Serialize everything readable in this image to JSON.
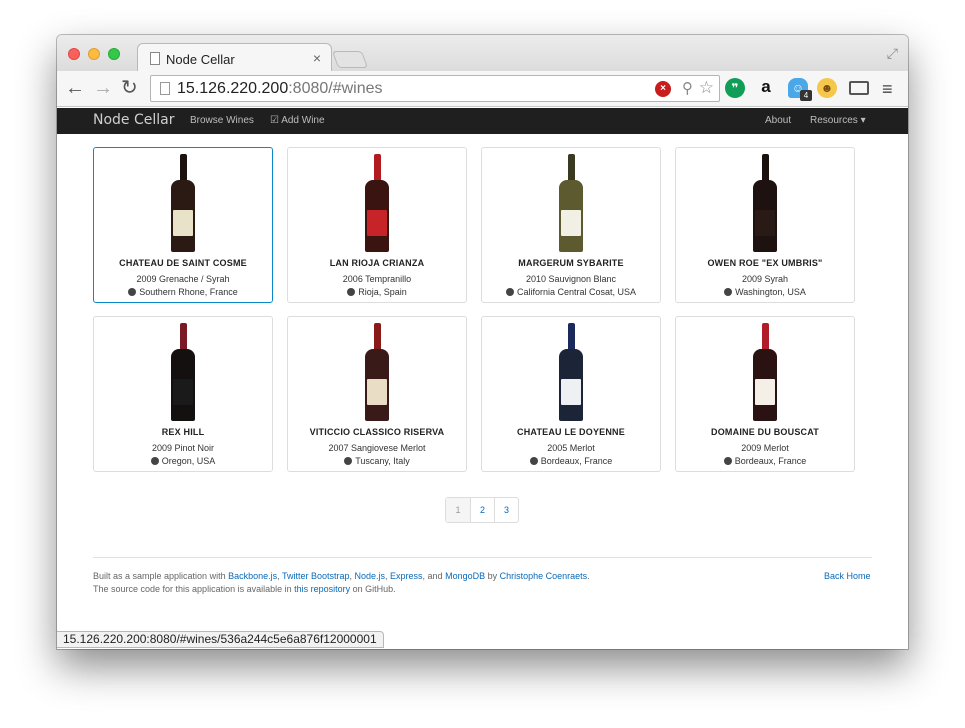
{
  "browser": {
    "tab_title": "Node Cellar",
    "tab_close": "×",
    "url_host": "15.126.220.200",
    "url_rest": ":8080/#wines",
    "status_url": "15.126.220.200:8080/#wines/536a244c5e6a876f12000001",
    "ghost_badge": "4",
    "nav_back": "←",
    "nav_forward": "→",
    "nav_reload": "↻",
    "menu": "≡"
  },
  "navbar": {
    "brand": "Node Cellar",
    "browse": "Browse Wines",
    "add": "Add Wine",
    "about": "About",
    "resources": "Resources ▾"
  },
  "wines": [
    {
      "name": "CHATEAU DE SAINT COSME",
      "grape": "2009 Grenache / Syrah",
      "region": "Southern Rhone, France",
      "glass": "#2b1a14",
      "label": "#e8e2c8",
      "neck": "#1c120e"
    },
    {
      "name": "LAN RIOJA CRIANZA",
      "grape": "2006 Tempranillo",
      "region": "Rioja, Spain",
      "glass": "#3a1410",
      "label": "#c7242a",
      "neck": "#b01c22"
    },
    {
      "name": "MARGERUM SYBARITE",
      "grape": "2010 Sauvignon Blanc",
      "region": "California Central Cosat, USA",
      "glass": "#5c5a2e",
      "label": "#f2efe4",
      "neck": "#3a3a22"
    },
    {
      "name": "OWEN ROE \"EX UMBRIS\"",
      "grape": "2009 Syrah",
      "region": "Washington, USA",
      "glass": "#1e1210",
      "label": "#2a1a16",
      "neck": "#1a100e"
    },
    {
      "name": "REX HILL",
      "grape": "2009 Pinot Noir",
      "region": "Oregon, USA",
      "glass": "#141010",
      "label": "#1a1a1a",
      "neck": "#7a1a24"
    },
    {
      "name": "VITICCIO CLASSICO RISERVA",
      "grape": "2007 Sangiovese Merlot",
      "region": "Tuscany, Italy",
      "glass": "#3a1a18",
      "label": "#e9ddc6",
      "neck": "#8a1a1a"
    },
    {
      "name": "CHATEAU LE DOYENNE",
      "grape": "2005 Merlot",
      "region": "Bordeaux, France",
      "glass": "#1c2438",
      "label": "#eef0f4",
      "neck": "#1a2a5a"
    },
    {
      "name": "DOMAINE DU BOUSCAT",
      "grape": "2009 Merlot",
      "region": "Bordeaux, France",
      "glass": "#2a1212",
      "label": "#f4f0e8",
      "neck": "#b01c28"
    }
  ],
  "pagination": [
    "1",
    "2",
    "3"
  ],
  "footer": {
    "l1_a": "Built as a sample application with ",
    "backbone": "Backbone.js",
    "sep1": ", ",
    "bootstrap": "Twitter Bootstrap",
    "sep2": ", ",
    "nodejs": "Node.js",
    "sep3": ", ",
    "express": "Express",
    "sep4": ", and ",
    "mongodb": "MongoDB",
    "by": " by ",
    "author": "Christophe Coenraets",
    "dot": ".",
    "l2_a": "The source code for this application is available in ",
    "repo": "this repository",
    "l2_b": " on GitHub.",
    "back_home": "Back Home"
  }
}
